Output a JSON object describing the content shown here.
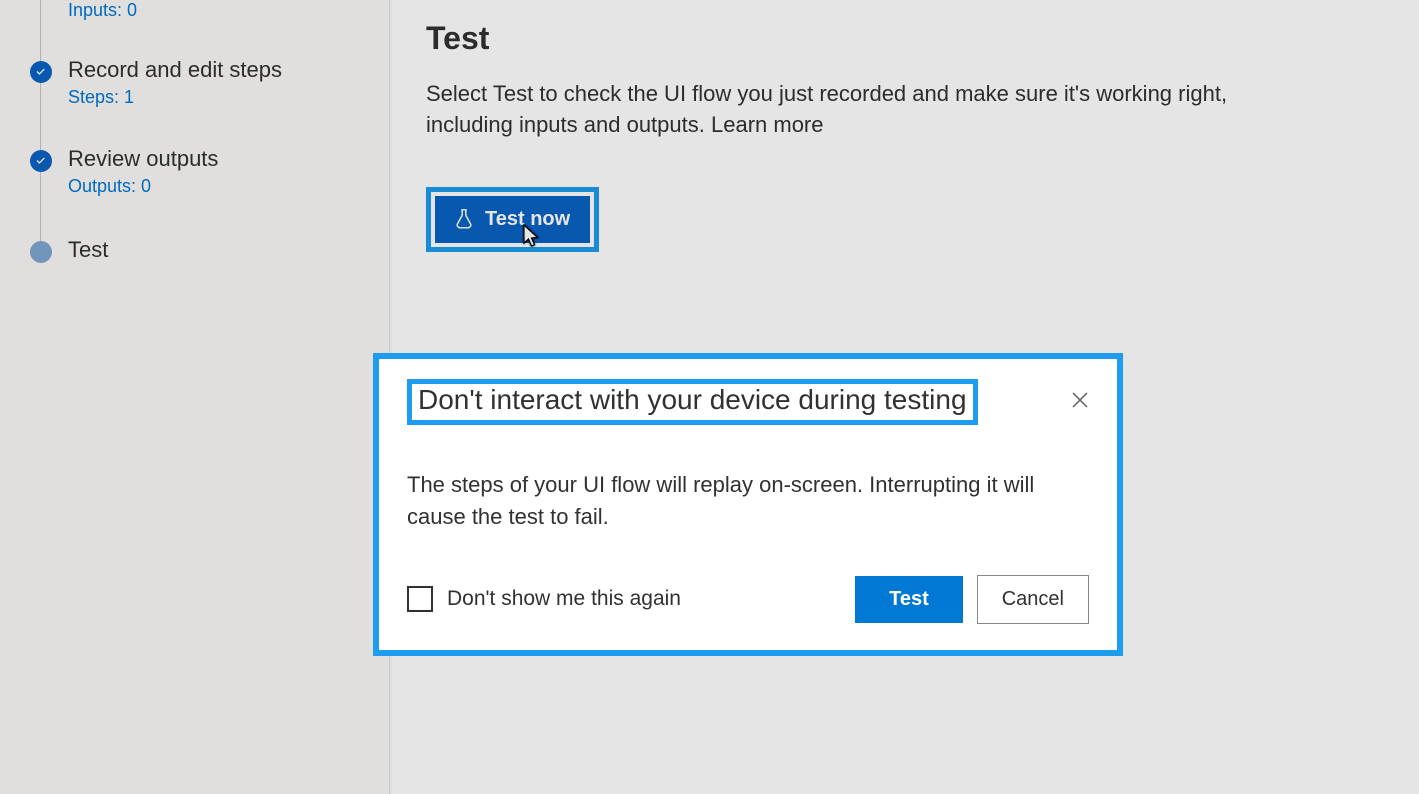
{
  "sidebar": {
    "steps": [
      {
        "title": "",
        "sub": "Inputs: 0",
        "status": "done-clipped"
      },
      {
        "title": "Record and edit steps",
        "sub": "Steps: 1",
        "status": "done"
      },
      {
        "title": "Review outputs",
        "sub": "Outputs: 0",
        "status": "done"
      },
      {
        "title": "Test",
        "sub": "",
        "status": "current"
      }
    ]
  },
  "main": {
    "heading": "Test",
    "description": "Select Test to check the UI flow you just recorded and make sure it's working right, including inputs and outputs. ",
    "learn_more": "Learn more",
    "test_now_label": "Test now"
  },
  "dialog": {
    "title": "Don't interact with your device during testing",
    "body": "The steps of your UI flow will replay on-screen. Interrupting it will cause the test to fail.",
    "dont_show_label": "Don't show me this again",
    "primary_label": "Test",
    "secondary_label": "Cancel"
  }
}
